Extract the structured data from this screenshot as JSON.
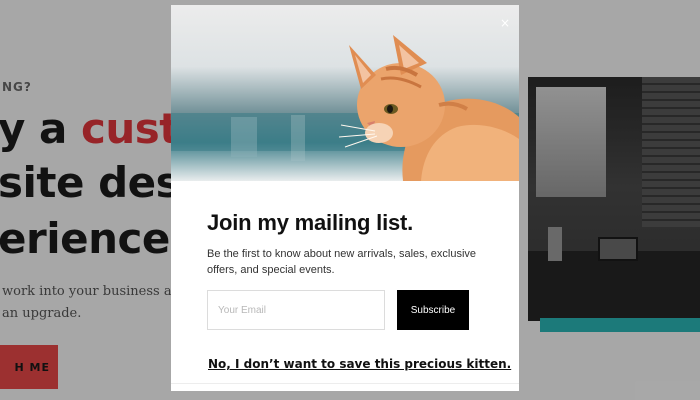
{
  "background_page": {
    "eyebrow": "NG?",
    "headline_line1_prefix": "y a ",
    "headline_line1_accent": "custo",
    "headline_line2": "site desi",
    "headline_line3": "erience",
    "body_line1": "work into your business and yo",
    "body_line2": "an upgrade.",
    "cta_label": "H ME",
    "accent_color": "#e2373c",
    "teal_color": "#2bb7b7"
  },
  "modal": {
    "close_icon": "×",
    "title": "Join my mailing list.",
    "description": "Be the first to know about new arrivals, sales, exclusive offers, and special events.",
    "email": {
      "placeholder": "Your Email",
      "value": ""
    },
    "subscribe_label": "Subscribe",
    "decline_label": "No, I don’t want to save this precious kitten.",
    "hero_image": "kitten-photo"
  }
}
